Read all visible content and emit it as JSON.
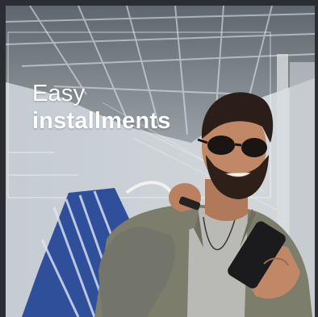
{
  "banner": {
    "headline_line1": "Easy",
    "headline_line2": "installments",
    "photo": "smiling man with sunglasses holding smartphone and shopping bag in a mall"
  },
  "colors": {
    "text": "#ffffff",
    "frame": "#2b2d33",
    "shirt": "#7c7d6a",
    "tshirt": "#b9b9b5",
    "bag": "#2f4f9a"
  }
}
